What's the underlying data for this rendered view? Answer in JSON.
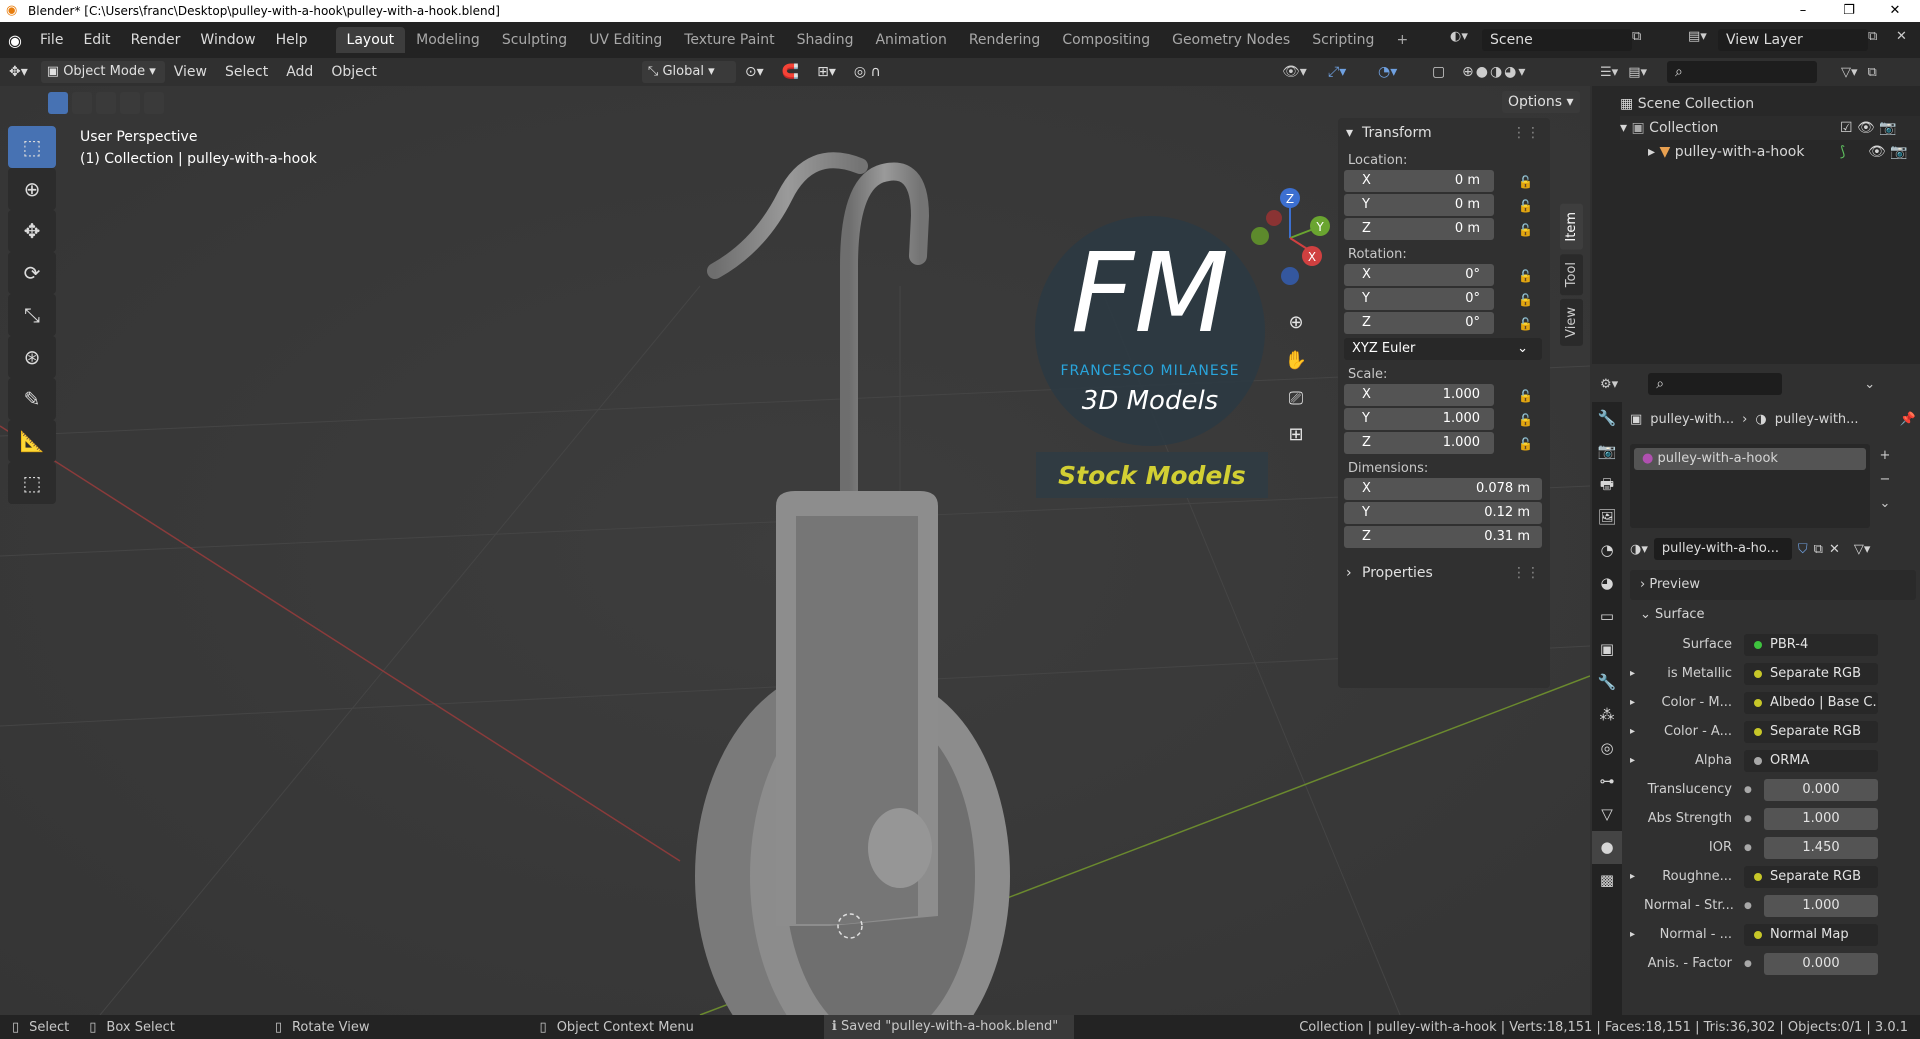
{
  "window": {
    "title": "Blender* [C:\\Users\\franc\\Desktop\\pulley-with-a-hook\\pulley-with-a-hook.blend]",
    "min": "–",
    "max": "❐",
    "close": "✕"
  },
  "menus": [
    "File",
    "Edit",
    "Render",
    "Window",
    "Help"
  ],
  "workspaces": [
    "Layout",
    "Modeling",
    "Sculpting",
    "UV Editing",
    "Texture Paint",
    "Shading",
    "Animation",
    "Rendering",
    "Compositing",
    "Geometry Nodes",
    "Scripting"
  ],
  "scene": "Scene",
  "view_layer": "View Layer",
  "header": {
    "mode": "Object Mode",
    "menus": [
      "View",
      "Select",
      "Add",
      "Object"
    ],
    "orientation": "Global",
    "options": "Options"
  },
  "viewport": {
    "perspective": "User Perspective",
    "collection_info": "(1) Collection | pulley-with-a-hook",
    "watermark": {
      "initials": "FM",
      "author": "FRANCESCO MILANESE",
      "line2": "3D Models",
      "badge": "Stock Models"
    },
    "gizmo": {
      "x": "X",
      "y": "Y",
      "z": "Z"
    }
  },
  "transform": {
    "title": "Transform",
    "location_label": "Location:",
    "rotation_label": "Rotation:",
    "scale_label": "Scale:",
    "dimensions_label": "Dimensions:",
    "location": [
      {
        "axis": "X",
        "value": "0 m"
      },
      {
        "axis": "Y",
        "value": "0 m"
      },
      {
        "axis": "Z",
        "value": "0 m"
      }
    ],
    "rotation": [
      {
        "axis": "X",
        "value": "0°"
      },
      {
        "axis": "Y",
        "value": "0°"
      },
      {
        "axis": "Z",
        "value": "0°"
      }
    ],
    "rotation_mode": "XYZ Euler",
    "scale": [
      {
        "axis": "X",
        "value": "1.000"
      },
      {
        "axis": "Y",
        "value": "1.000"
      },
      {
        "axis": "Z",
        "value": "1.000"
      }
    ],
    "dimensions": [
      {
        "axis": "X",
        "value": "0.078 m"
      },
      {
        "axis": "Y",
        "value": "0.12 m"
      },
      {
        "axis": "Z",
        "value": "0.31 m"
      }
    ],
    "properties": "Properties"
  },
  "ntabs": [
    "Item",
    "Tool",
    "View"
  ],
  "outliner": {
    "scene_collection": "Scene Collection",
    "collection": "Collection",
    "object": "pulley-with-a-hook"
  },
  "properties": {
    "breadcrumb_obj": "pulley-with...",
    "breadcrumb_mat": "pulley-with...",
    "slot": "pulley-with-a-hook",
    "material": "pulley-with-a-ho...",
    "preview": "Preview",
    "surface_panel": "Surface",
    "rows": [
      {
        "label": "Surface",
        "value": "PBR-4",
        "kind": "green"
      },
      {
        "label": "is Metallic",
        "value": "Separate RGB",
        "kind": "yellow",
        "arrow": true
      },
      {
        "label": "Color - M...",
        "value": "Albedo | Base C...",
        "kind": "yellow",
        "arrow": true
      },
      {
        "label": "Color - A...",
        "value": "Separate RGB",
        "kind": "yellow",
        "arrow": true
      },
      {
        "label": "Alpha",
        "value": "ORMA",
        "kind": "gray",
        "arrow": true
      },
      {
        "label": "Translucency",
        "value": "0.000",
        "kind": "num"
      },
      {
        "label": "Abs Strength",
        "value": "1.000",
        "kind": "num"
      },
      {
        "label": "IOR",
        "value": "1.450",
        "kind": "num"
      },
      {
        "label": "Roughne...",
        "value": "Separate RGB",
        "kind": "yellow",
        "arrow": true
      },
      {
        "label": "Normal - Str...",
        "value": "1.000",
        "kind": "num"
      },
      {
        "label": "Normal - ...",
        "value": "Normal Map",
        "kind": "yellow",
        "arrow": true
      },
      {
        "label": "Anis. - Factor",
        "value": "0.000",
        "kind": "num"
      }
    ]
  },
  "status": {
    "select": "Select",
    "box_select": "Box Select",
    "rotate": "Rotate View",
    "context": "Object Context Menu",
    "saved": "Saved \"pulley-with-a-hook.blend\"",
    "stats": "Collection | pulley-with-a-hook | Verts:18,151 | Faces:18,151 | Tris:36,302 | Objects:0/1 | 3.0.1"
  }
}
